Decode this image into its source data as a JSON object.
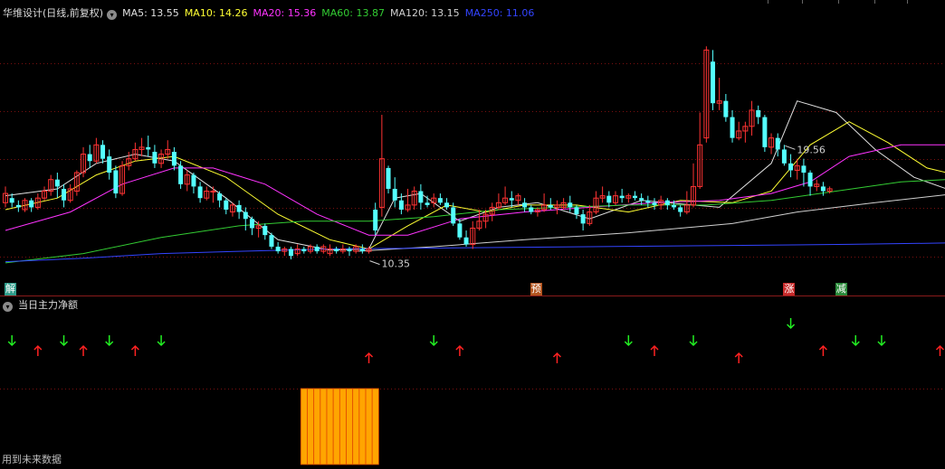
{
  "header": {
    "stock": "华维设计(日线,前复权)",
    "ma": [
      {
        "label": "MA5: 13.55",
        "color": "#e0e0e0"
      },
      {
        "label": "MA10: 14.26",
        "color": "#ffff33"
      },
      {
        "label": "MA20: 15.36",
        "color": "#ff33ff"
      },
      {
        "label": "MA60: 13.87",
        "color": "#33cc33"
      },
      {
        "label": "MA120: 13.15",
        "color": "#d0d0d0"
      },
      {
        "label": "MA250: 11.06",
        "color": "#3344ff"
      }
    ]
  },
  "sub_header": {
    "title": "当日主力净额"
  },
  "footer": {
    "text": "用到未来数据"
  },
  "tags": [
    {
      "text": "解",
      "bg": "#2f9c8a",
      "idx": 0
    },
    {
      "text": "预",
      "bg": "#b3541e",
      "idx": 81
    },
    {
      "text": "涨",
      "bg": "#c82a2a",
      "idx": 120
    },
    {
      "text": "减",
      "bg": "#2a8a3a",
      "idx": 128
    }
  ],
  "colors": {
    "up": "#ff3333",
    "down": "#54ffff",
    "grid": "#7a1010",
    "arrow_up": "#ff2222",
    "arrow_down": "#22ee22",
    "bar": "#ffa500"
  },
  "chart_data": {
    "type": "candlestick",
    "ylim": [
      10,
      20
    ],
    "annotations": [
      {
        "text": "19.56",
        "idx": 120
      },
      {
        "text": "10.35",
        "idx": 56
      }
    ],
    "candles": [
      [
        12.8,
        13.2,
        13.5,
        12.6
      ],
      [
        13.0,
        12.8,
        13.2,
        12.6
      ],
      [
        12.7,
        12.6,
        12.9,
        12.4
      ],
      [
        12.5,
        12.9,
        13.0,
        12.4
      ],
      [
        12.9,
        12.6,
        13.0,
        12.4
      ],
      [
        12.6,
        13.0,
        13.2,
        12.5
      ],
      [
        13.0,
        13.3,
        13.5,
        12.9
      ],
      [
        13.3,
        13.8,
        14.0,
        13.1
      ],
      [
        13.8,
        13.5,
        14.1,
        13.0
      ],
      [
        13.4,
        12.9,
        13.6,
        12.6
      ],
      [
        12.9,
        13.4,
        13.6,
        12.8
      ],
      [
        13.3,
        14.1,
        14.2,
        13.1
      ],
      [
        14.1,
        14.9,
        15.2,
        13.9
      ],
      [
        14.9,
        14.6,
        15.3,
        14.3
      ],
      [
        14.6,
        15.3,
        15.6,
        14.5
      ],
      [
        15.3,
        14.7,
        15.5,
        14.5
      ],
      [
        14.8,
        14.1,
        15.1,
        13.8
      ],
      [
        14.2,
        13.2,
        14.4,
        13.0
      ],
      [
        13.2,
        14.4,
        14.6,
        13.1
      ],
      [
        14.4,
        14.7,
        15.0,
        14.2
      ],
      [
        14.7,
        15.1,
        15.4,
        14.6
      ],
      [
        15.1,
        15.2,
        15.6,
        14.8
      ],
      [
        15.2,
        15.1,
        15.7,
        14.8
      ],
      [
        15.0,
        14.5,
        15.3,
        14.3
      ],
      [
        14.5,
        14.9,
        15.1,
        14.3
      ],
      [
        14.9,
        15.1,
        15.5,
        14.7
      ],
      [
        15.0,
        14.4,
        15.2,
        14.2
      ],
      [
        14.4,
        13.6,
        14.6,
        13.4
      ],
      [
        13.6,
        14.0,
        14.2,
        13.3
      ],
      [
        14.0,
        13.5,
        14.1,
        13.2
      ],
      [
        13.5,
        13.0,
        13.7,
        12.8
      ],
      [
        13.0,
        13.3,
        13.5,
        12.9
      ],
      [
        13.3,
        13.3,
        13.5,
        12.8
      ],
      [
        13.2,
        12.9,
        13.3,
        12.6
      ],
      [
        12.9,
        12.5,
        13.0,
        12.3
      ],
      [
        12.4,
        12.7,
        12.8,
        12.2
      ],
      [
        12.7,
        12.4,
        12.9,
        12.1
      ],
      [
        12.4,
        12.1,
        12.6,
        11.6
      ],
      [
        12.1,
        11.7,
        12.2,
        11.4
      ],
      [
        11.7,
        11.8,
        12.0,
        11.3
      ],
      [
        11.8,
        11.4,
        11.9,
        11.2
      ],
      [
        11.4,
        10.9,
        11.5,
        10.8
      ],
      [
        10.9,
        10.7,
        11.1,
        10.6
      ],
      [
        10.7,
        10.8,
        10.9,
        10.5
      ],
      [
        10.8,
        10.5,
        10.9,
        10.35
      ],
      [
        10.6,
        10.8,
        11.0,
        10.5
      ],
      [
        10.8,
        10.7,
        10.9,
        10.6
      ],
      [
        10.7,
        10.9,
        11.0,
        10.6
      ],
      [
        10.9,
        10.7,
        11.0,
        10.6
      ],
      [
        10.7,
        10.9,
        11.0,
        10.6
      ],
      [
        10.6,
        10.8,
        11.0,
        10.5
      ],
      [
        10.8,
        10.7,
        10.9,
        10.6
      ],
      [
        10.7,
        10.8,
        11.0,
        10.6
      ],
      [
        10.8,
        10.7,
        10.9,
        10.5
      ],
      [
        10.7,
        10.9,
        11.0,
        10.6
      ],
      [
        10.8,
        10.7,
        11.0,
        10.6
      ],
      [
        10.7,
        10.8,
        10.9,
        10.6
      ],
      [
        12.5,
        11.6,
        12.8,
        11.4
      ],
      [
        12.6,
        14.7,
        16.6,
        12.2
      ],
      [
        14.3,
        13.4,
        14.4,
        13.2
      ],
      [
        13.4,
        12.9,
        13.9,
        12.6
      ],
      [
        12.9,
        12.5,
        13.2,
        12.3
      ],
      [
        12.5,
        12.7,
        13.4,
        12.4
      ],
      [
        12.7,
        13.3,
        13.5,
        12.5
      ],
      [
        13.3,
        12.8,
        13.6,
        12.5
      ],
      [
        12.8,
        12.7,
        13.1,
        12.6
      ],
      [
        12.8,
        13.0,
        13.2,
        12.6
      ],
      [
        13.0,
        12.8,
        13.2,
        12.7
      ],
      [
        12.8,
        12.6,
        13.0,
        12.5
      ],
      [
        12.6,
        11.9,
        12.8,
        11.8
      ],
      [
        11.9,
        11.3,
        12.1,
        11.2
      ],
      [
        11.3,
        11.0,
        11.6,
        10.9
      ],
      [
        11.0,
        11.7,
        12.0,
        10.8
      ],
      [
        11.7,
        12.0,
        12.5,
        11.6
      ],
      [
        12.0,
        12.3,
        12.5,
        11.7
      ],
      [
        12.3,
        12.6,
        12.8,
        12.0
      ],
      [
        12.6,
        12.8,
        13.2,
        12.5
      ],
      [
        12.8,
        13.0,
        13.5,
        12.7
      ],
      [
        13.0,
        12.9,
        13.3,
        12.6
      ],
      [
        12.9,
        13.1,
        13.2,
        12.7
      ],
      [
        12.8,
        12.6,
        13.0,
        12.4
      ],
      [
        12.6,
        12.4,
        12.7,
        12.3
      ],
      [
        12.4,
        12.5,
        12.6,
        12.2
      ],
      [
        12.5,
        12.7,
        13.2,
        12.4
      ],
      [
        12.7,
        12.6,
        13.0,
        12.5
      ],
      [
        12.6,
        12.7,
        12.9,
        12.3
      ],
      [
        12.6,
        12.8,
        13.0,
        12.5
      ],
      [
        12.8,
        12.6,
        13.1,
        12.4
      ],
      [
        12.6,
        12.3,
        12.7,
        12.1
      ],
      [
        12.3,
        11.9,
        12.5,
        11.6
      ],
      [
        11.9,
        12.4,
        12.7,
        11.8
      ],
      [
        12.4,
        13.0,
        13.3,
        12.3
      ],
      [
        13.0,
        13.1,
        13.5,
        12.8
      ],
      [
        13.1,
        12.8,
        13.3,
        12.6
      ],
      [
        12.8,
        13.1,
        13.3,
        12.7
      ],
      [
        13.1,
        13.0,
        13.4,
        12.8
      ],
      [
        13.0,
        13.1,
        13.2,
        12.8
      ],
      [
        13.1,
        13.0,
        13.3,
        12.9
      ],
      [
        13.0,
        12.9,
        13.2,
        12.7
      ],
      [
        12.9,
        12.8,
        13.1,
        12.6
      ],
      [
        12.8,
        12.7,
        13.0,
        12.5
      ],
      [
        12.7,
        12.9,
        13.1,
        12.5
      ],
      [
        12.9,
        12.7,
        13.0,
        12.5
      ],
      [
        12.7,
        12.6,
        12.9,
        12.5
      ],
      [
        12.6,
        12.4,
        12.7,
        12.2
      ],
      [
        12.4,
        12.7,
        13.3,
        12.3
      ],
      [
        12.7,
        13.5,
        14.5,
        12.6
      ],
      [
        13.5,
        15.3,
        16.7,
        13.4
      ],
      [
        15.6,
        19.4,
        19.56,
        15.4
      ],
      [
        18.9,
        17.1,
        19.4,
        16.8
      ],
      [
        17.1,
        17.2,
        18.2,
        16.8
      ],
      [
        17.2,
        16.5,
        17.5,
        16.3
      ],
      [
        16.5,
        15.6,
        16.8,
        15.4
      ],
      [
        15.6,
        15.9,
        16.3,
        15.5
      ],
      [
        15.9,
        16.1,
        16.3,
        15.4
      ],
      [
        16.1,
        16.8,
        17.2,
        15.7
      ],
      [
        16.8,
        16.5,
        17.0,
        16.2
      ],
      [
        16.5,
        15.2,
        16.6,
        15.0
      ],
      [
        15.2,
        15.6,
        15.8,
        14.9
      ],
      [
        15.6,
        15.1,
        15.8,
        14.8
      ],
      [
        15.1,
        14.5,
        15.3,
        14.4
      ],
      [
        14.5,
        14.2,
        14.9,
        13.9
      ],
      [
        14.2,
        14.4,
        14.7,
        13.8
      ],
      [
        14.4,
        14.1,
        14.7,
        13.5
      ],
      [
        14.1,
        13.5,
        14.2,
        13.1
      ],
      [
        13.5,
        13.6,
        13.8,
        13.3
      ],
      [
        13.5,
        13.3,
        13.7,
        13.1
      ],
      [
        13.3,
        13.4,
        13.5,
        13.2
      ]
    ],
    "ma": {
      "MA5": [
        [
          0,
          13.1
        ],
        [
          8,
          13.4
        ],
        [
          14,
          14.5
        ],
        [
          20,
          14.9
        ],
        [
          26,
          14.6
        ],
        [
          34,
          13.0
        ],
        [
          42,
          11.2
        ],
        [
          50,
          10.75
        ],
        [
          56,
          10.8
        ],
        [
          60,
          13.0
        ],
        [
          64,
          13.2
        ],
        [
          70,
          12.0
        ],
        [
          76,
          12.6
        ],
        [
          82,
          12.8
        ],
        [
          90,
          12.1
        ],
        [
          98,
          12.9
        ],
        [
          110,
          12.6
        ],
        [
          118,
          14.5
        ],
        [
          122,
          17.2
        ],
        [
          128,
          16.7
        ],
        [
          134,
          15.1
        ],
        [
          140,
          13.9
        ],
        [
          145,
          13.4
        ]
      ],
      "MA10": [
        [
          0,
          12.5
        ],
        [
          8,
          13.0
        ],
        [
          14,
          14.0
        ],
        [
          20,
          14.6
        ],
        [
          26,
          14.8
        ],
        [
          34,
          13.9
        ],
        [
          42,
          12.3
        ],
        [
          50,
          11.2
        ],
        [
          56,
          10.8
        ],
        [
          62,
          11.8
        ],
        [
          68,
          12.7
        ],
        [
          74,
          12.4
        ],
        [
          80,
          12.7
        ],
        [
          88,
          12.7
        ],
        [
          96,
          12.4
        ],
        [
          104,
          12.9
        ],
        [
          112,
          12.8
        ],
        [
          118,
          13.3
        ],
        [
          124,
          15.3
        ],
        [
          130,
          16.3
        ],
        [
          136,
          15.4
        ],
        [
          142,
          14.3
        ],
        [
          145,
          14.1
        ]
      ],
      "MA20": [
        [
          0,
          11.6
        ],
        [
          10,
          12.4
        ],
        [
          18,
          13.6
        ],
        [
          26,
          14.3
        ],
        [
          32,
          14.3
        ],
        [
          40,
          13.6
        ],
        [
          48,
          12.3
        ],
        [
          56,
          11.4
        ],
        [
          62,
          11.4
        ],
        [
          70,
          12.1
        ],
        [
          80,
          12.4
        ],
        [
          90,
          12.6
        ],
        [
          100,
          12.8
        ],
        [
          110,
          12.9
        ],
        [
          118,
          13.2
        ],
        [
          124,
          13.7
        ],
        [
          130,
          14.8
        ],
        [
          138,
          15.3
        ],
        [
          145,
          15.3
        ]
      ],
      "MA60": [
        [
          0,
          10.2
        ],
        [
          12,
          10.6
        ],
        [
          24,
          11.3
        ],
        [
          36,
          11.8
        ],
        [
          46,
          12.0
        ],
        [
          56,
          12.0
        ],
        [
          66,
          12.2
        ],
        [
          76,
          12.5
        ],
        [
          86,
          12.6
        ],
        [
          96,
          12.7
        ],
        [
          108,
          12.7
        ],
        [
          118,
          12.9
        ],
        [
          128,
          13.3
        ],
        [
          138,
          13.7
        ],
        [
          145,
          13.8
        ]
      ],
      "MA120": [
        [
          54,
          10.7
        ],
        [
          66,
          10.9
        ],
        [
          80,
          11.2
        ],
        [
          96,
          11.5
        ],
        [
          112,
          11.9
        ],
        [
          122,
          12.4
        ],
        [
          134,
          12.8
        ],
        [
          145,
          13.15
        ]
      ],
      "MA250": [
        [
          0,
          10.25
        ],
        [
          12,
          10.4
        ],
        [
          24,
          10.6
        ],
        [
          36,
          10.7
        ],
        [
          50,
          10.8
        ],
        [
          70,
          10.85
        ],
        [
          90,
          10.9
        ],
        [
          110,
          10.95
        ],
        [
          130,
          11.0
        ],
        [
          145,
          11.06
        ]
      ]
    },
    "signals": [
      {
        "idx": 1,
        "dir": "down",
        "row": 0
      },
      {
        "idx": 5,
        "dir": "up",
        "row": 1
      },
      {
        "idx": 9,
        "dir": "down",
        "row": 0
      },
      {
        "idx": 12,
        "dir": "up",
        "row": 1
      },
      {
        "idx": 16,
        "dir": "down",
        "row": 0
      },
      {
        "idx": 20,
        "dir": "up",
        "row": 1
      },
      {
        "idx": 24,
        "dir": "down",
        "row": 0
      },
      {
        "idx": 56,
        "dir": "up",
        "row": 2
      },
      {
        "idx": 66,
        "dir": "down",
        "row": 0
      },
      {
        "idx": 70,
        "dir": "up",
        "row": 1
      },
      {
        "idx": 85,
        "dir": "up",
        "row": 2
      },
      {
        "idx": 96,
        "dir": "down",
        "row": 0
      },
      {
        "idx": 100,
        "dir": "up",
        "row": 1
      },
      {
        "idx": 106,
        "dir": "down",
        "row": 0
      },
      {
        "idx": 113,
        "dir": "up",
        "row": 2
      },
      {
        "idx": 121,
        "dir": "down",
        "row": -1
      },
      {
        "idx": 126,
        "dir": "up",
        "row": 1
      },
      {
        "idx": 131,
        "dir": "down",
        "row": 0
      },
      {
        "idx": 135,
        "dir": "down",
        "row": 0
      },
      {
        "idx": 144,
        "dir": "up",
        "row": 1
      }
    ],
    "net_bars": {
      "start": 46,
      "end": 57,
      "value": 1
    }
  }
}
